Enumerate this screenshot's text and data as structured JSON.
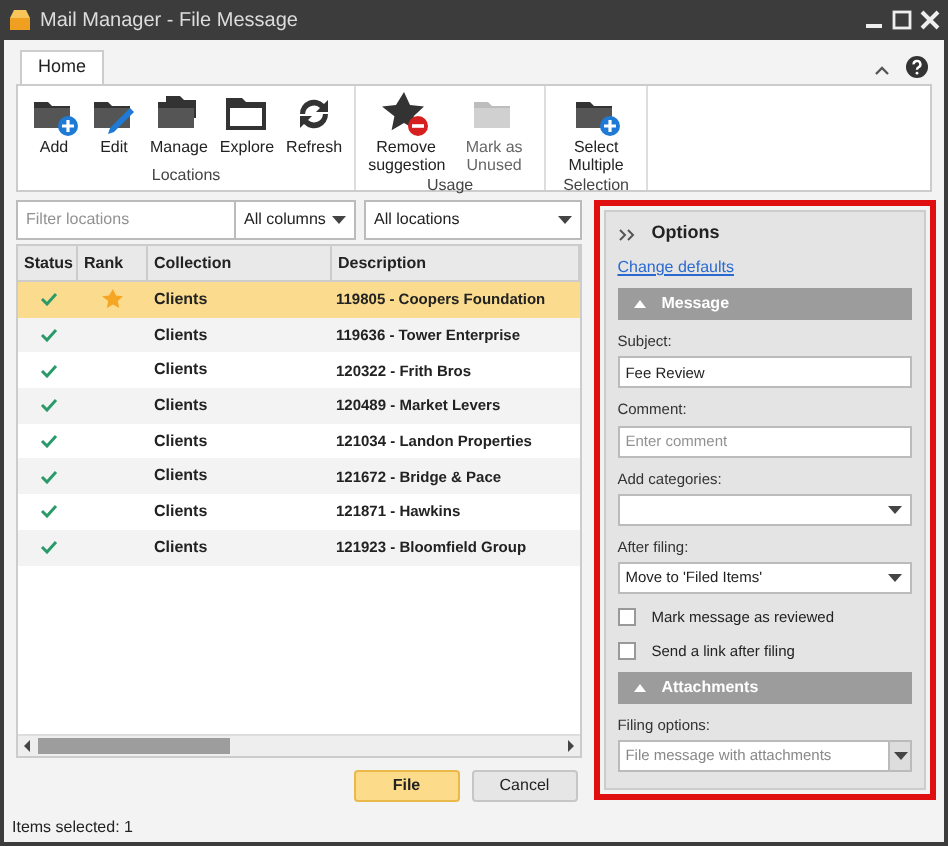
{
  "window": {
    "title": "Mail Manager - File Message"
  },
  "ribbon": {
    "tabs": [
      {
        "label": "Home",
        "selected": true
      }
    ],
    "groups": [
      {
        "label": "Locations",
        "buttons": [
          {
            "label": "Add",
            "kind": "add",
            "disabled": false
          },
          {
            "label": "Edit",
            "kind": "edit",
            "disabled": false
          },
          {
            "label": "Manage",
            "kind": "manage",
            "disabled": false
          },
          {
            "label": "Explore",
            "kind": "explore",
            "disabled": false
          },
          {
            "label": "Refresh",
            "kind": "refresh",
            "disabled": false
          }
        ]
      },
      {
        "label": "Usage",
        "buttons": [
          {
            "label": "Remove suggestion",
            "kind": "remove",
            "disabled": false
          },
          {
            "label": "Mark as Unused",
            "kind": "unused",
            "disabled": true
          }
        ]
      },
      {
        "label": "Selection",
        "buttons": [
          {
            "label": "Select Multiple",
            "kind": "add",
            "disabled": false
          }
        ]
      }
    ]
  },
  "filter": {
    "placeholder": "Filter locations",
    "columns": "All columns",
    "scope": "All locations"
  },
  "table": {
    "columns": [
      "Status",
      "Rank",
      "Collection",
      "Description"
    ],
    "rows": [
      {
        "selected": true,
        "starred": true,
        "collection": "Clients",
        "description": "119805 - Coopers Foundation"
      },
      {
        "selected": false,
        "starred": false,
        "collection": "Clients",
        "description": "119636 - Tower Enterprise"
      },
      {
        "selected": false,
        "starred": false,
        "collection": "Clients",
        "description": "120322 - Frith Bros"
      },
      {
        "selected": false,
        "starred": false,
        "collection": "Clients",
        "description": "120489 - Market Levers"
      },
      {
        "selected": false,
        "starred": false,
        "collection": "Clients",
        "description": "121034 - Landon Properties"
      },
      {
        "selected": false,
        "starred": false,
        "collection": "Clients",
        "description": "121672 - Bridge & Pace"
      },
      {
        "selected": false,
        "starred": false,
        "collection": "Clients",
        "description": "121871 - Hawkins"
      },
      {
        "selected": false,
        "starred": false,
        "collection": "Clients",
        "description": "121923 - Bloomfield Group"
      }
    ]
  },
  "buttons": [
    {
      "label": "File",
      "primary": true
    },
    {
      "label": "Cancel",
      "primary": false
    }
  ],
  "status_bar": "Items selected: 1",
  "options": {
    "title": "Options",
    "link": "Change defaults",
    "message_section": {
      "title": "Message",
      "expanded": true,
      "subject_label": "Subject:",
      "subject": "Fee Review",
      "comment_label": "Comment:",
      "comment_placeholder": "Enter comment",
      "categories_label": "Add categories:",
      "after_label": "After filing:",
      "after_value": "Move to 'Filed Items'",
      "checkboxes": [
        {
          "label": "Mark message as reviewed",
          "checked": false
        },
        {
          "label": "Send a link after filing",
          "checked": false
        }
      ]
    },
    "attachments_section": {
      "title": "Attachments",
      "expanded": true,
      "filing_label": "Filing options:",
      "filing_value": "File message with attachments"
    }
  }
}
